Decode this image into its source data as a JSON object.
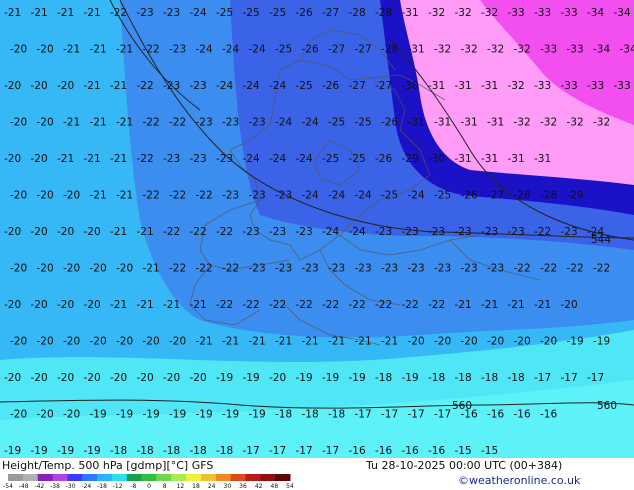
{
  "map": {
    "rows": [
      [
        "-21",
        "-21",
        "-21",
        "-21",
        "-22",
        "-23",
        "-23",
        "-24",
        "-25",
        "-25",
        "-25",
        "-26",
        "-27",
        "-28",
        "-28",
        "-31",
        "-32",
        "-32",
        "-32",
        "-33",
        "-33",
        "-33",
        "-34",
        "-34"
      ],
      [
        "-20",
        "-20",
        "-21",
        "-21",
        "-21",
        "-22",
        "-23",
        "-24",
        "-24",
        "-24",
        "-25",
        "-26",
        "-27",
        "-27",
        "-28",
        "-31",
        "-32",
        "-32",
        "-32",
        "-32",
        "-33",
        "-33",
        "-34",
        "-34"
      ],
      [
        "-20",
        "-20",
        "-20",
        "-21",
        "-21",
        "-22",
        "-23",
        "-23",
        "-24",
        "-24",
        "-24",
        "-25",
        "-26",
        "-27",
        "-27",
        "-30",
        "-31",
        "-31",
        "-31",
        "-32",
        "-33",
        "-33",
        "-33",
        "-33"
      ],
      [
        "-20",
        "-20",
        "-21",
        "-21",
        "-21",
        "-22",
        "-22",
        "-23",
        "-23",
        "-23",
        "-24",
        "-24",
        "-25",
        "-25",
        "-26",
        "-31",
        "-31",
        "-31",
        "-31",
        "-32",
        "-32",
        "-32",
        "-32"
      ],
      [
        "-20",
        "-20",
        "-21",
        "-21",
        "-21",
        "-22",
        "-23",
        "-23",
        "-23",
        "-24",
        "-24",
        "-24",
        "-25",
        "-25",
        "-26",
        "-29",
        "-30",
        "-31",
        "-31",
        "-31",
        "-31"
      ],
      [
        "-20",
        "-20",
        "-20",
        "-21",
        "-21",
        "-22",
        "-22",
        "-22",
        "-23",
        "-23",
        "-23",
        "-24",
        "-24",
        "-24",
        "-25",
        "-24",
        "-25",
        "-26",
        "-27",
        "-28",
        "-28",
        "-29"
      ],
      [
        "-20",
        "-20",
        "-20",
        "-20",
        "-21",
        "-21",
        "-22",
        "-22",
        "-22",
        "-23",
        "-23",
        "-23",
        "-24",
        "-24",
        "-23",
        "-23",
        "-23",
        "-23",
        "-23",
        "-23",
        "-22",
        "-23",
        "-24"
      ],
      [
        "-20",
        "-20",
        "-20",
        "-20",
        "-20",
        "-21",
        "-22",
        "-22",
        "-22",
        "-23",
        "-23",
        "-23",
        "-23",
        "-23",
        "-23",
        "-23",
        "-23",
        "-23",
        "-23",
        "-22",
        "-22",
        "-22",
        "-22"
      ],
      [
        "-20",
        "-20",
        "-20",
        "-20",
        "-21",
        "-21",
        "-21",
        "-21",
        "-22",
        "-22",
        "-22",
        "-22",
        "-22",
        "-22",
        "-22",
        "-22",
        "-22",
        "-21",
        "-21",
        "-21",
        "-21",
        "-20"
      ],
      [
        "-20",
        "-20",
        "-20",
        "-20",
        "-20",
        "-20",
        "-20",
        "-21",
        "-21",
        "-21",
        "-21",
        "-21",
        "-21",
        "-21",
        "-21",
        "-20",
        "-20",
        "-20",
        "-20",
        "-20",
        "-20",
        "-19",
        "-19"
      ],
      [
        "-20",
        "-20",
        "-20",
        "-20",
        "-20",
        "-20",
        "-20",
        "-20",
        "-19",
        "-19",
        "-20",
        "-19",
        "-19",
        "-19",
        "-18",
        "-19",
        "-18",
        "-18",
        "-18",
        "-18",
        "-17",
        "-17",
        "-17"
      ],
      [
        "-20",
        "-20",
        "-20",
        "-19",
        "-19",
        "-19",
        "-19",
        "-19",
        "-19",
        "-19",
        "-18",
        "-18",
        "-18",
        "-17",
        "-17",
        "-17",
        "-17",
        "-16",
        "-16",
        "-16",
        "-16"
      ],
      [
        "-19",
        "-19",
        "-19",
        "-19",
        "-18",
        "-18",
        "-18",
        "-18",
        "-18",
        "-17",
        "-17",
        "-17",
        "-17",
        "-16",
        "-16",
        "-16",
        "-16",
        "-15",
        "-15"
      ]
    ],
    "contour_labels": [
      "560",
      "560",
      "544"
    ],
    "colors": {
      "lightest_cyan": "#4fe6f6",
      "light_blue": "#35b8f5",
      "mid_blue": "#3b8df0",
      "blue": "#3a63e8",
      "deep_blue": "#1b12c8",
      "pink": "#ff9cf7",
      "magenta": "#f24ef0"
    }
  },
  "footer": {
    "title": "Height/Temp. 500 hPa [gdmp][°C] GFS",
    "datetime": "Tu 28-10-2025 00:00 UTC (00+384)",
    "credit": "©weatheronline.co.uk",
    "legend_ticks": [
      "-54",
      "-48",
      "-42",
      "-38",
      "-30",
      "-24",
      "-18",
      "-12",
      "-8",
      "0",
      "8",
      "12",
      "18",
      "24",
      "30",
      "36",
      "42",
      "48",
      "54"
    ],
    "legend_colors": [
      "#9a9a9a",
      "#b0b0b0",
      "#8a1fbf",
      "#b144e0",
      "#3a3aff",
      "#2a7bff",
      "#2ab4ff",
      "#2de0f0",
      "#18a050",
      "#2fbf3f",
      "#6cd84a",
      "#a8ec52",
      "#f0f040",
      "#f0c030",
      "#f08a20",
      "#e04a1a",
      "#c01818",
      "#901010",
      "#5a0808"
    ]
  }
}
